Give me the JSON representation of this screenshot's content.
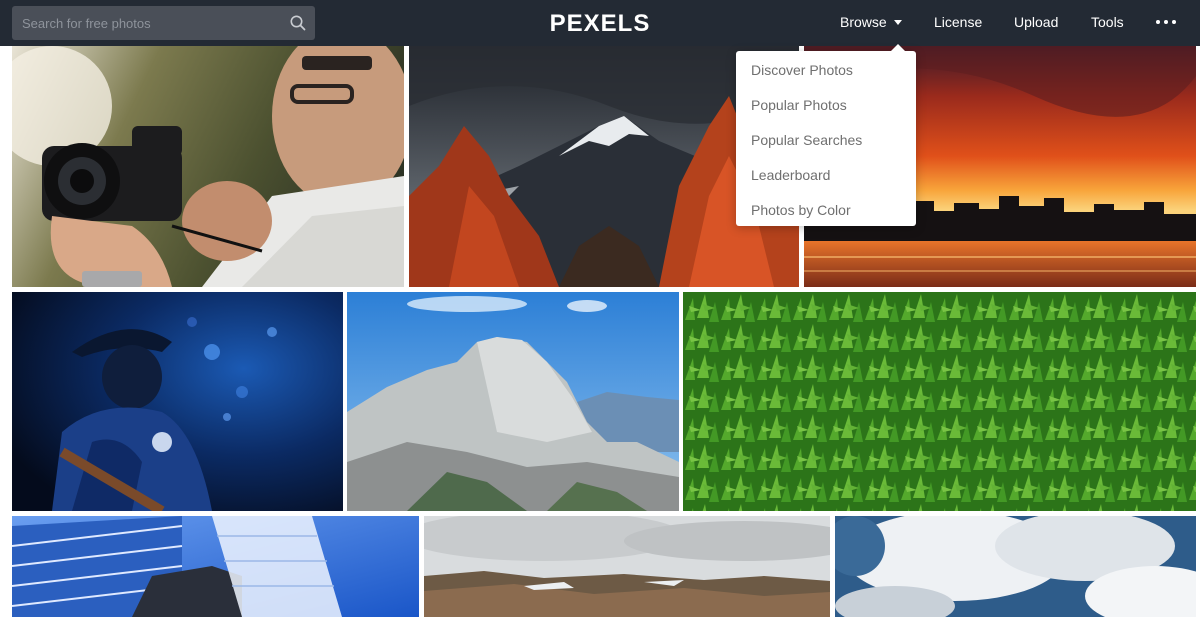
{
  "header": {
    "search_placeholder": "Search for free photos",
    "logo": "PEXELS",
    "nav": {
      "browse": "Browse",
      "license": "License",
      "upload": "Upload",
      "tools": "Tools"
    },
    "icons": {
      "search": "search-icon",
      "browse_caret": "caret-down-icon",
      "more": "more-horizontal-icon"
    }
  },
  "browse_menu": {
    "items": [
      "Discover Photos",
      "Popular Photos",
      "Popular Searches",
      "Leaderboard",
      "Photos by Color"
    ]
  },
  "colors": {
    "topbar": "#232a34",
    "search_bg": "#4a4f58",
    "menu_text": "#6f6f6f"
  }
}
